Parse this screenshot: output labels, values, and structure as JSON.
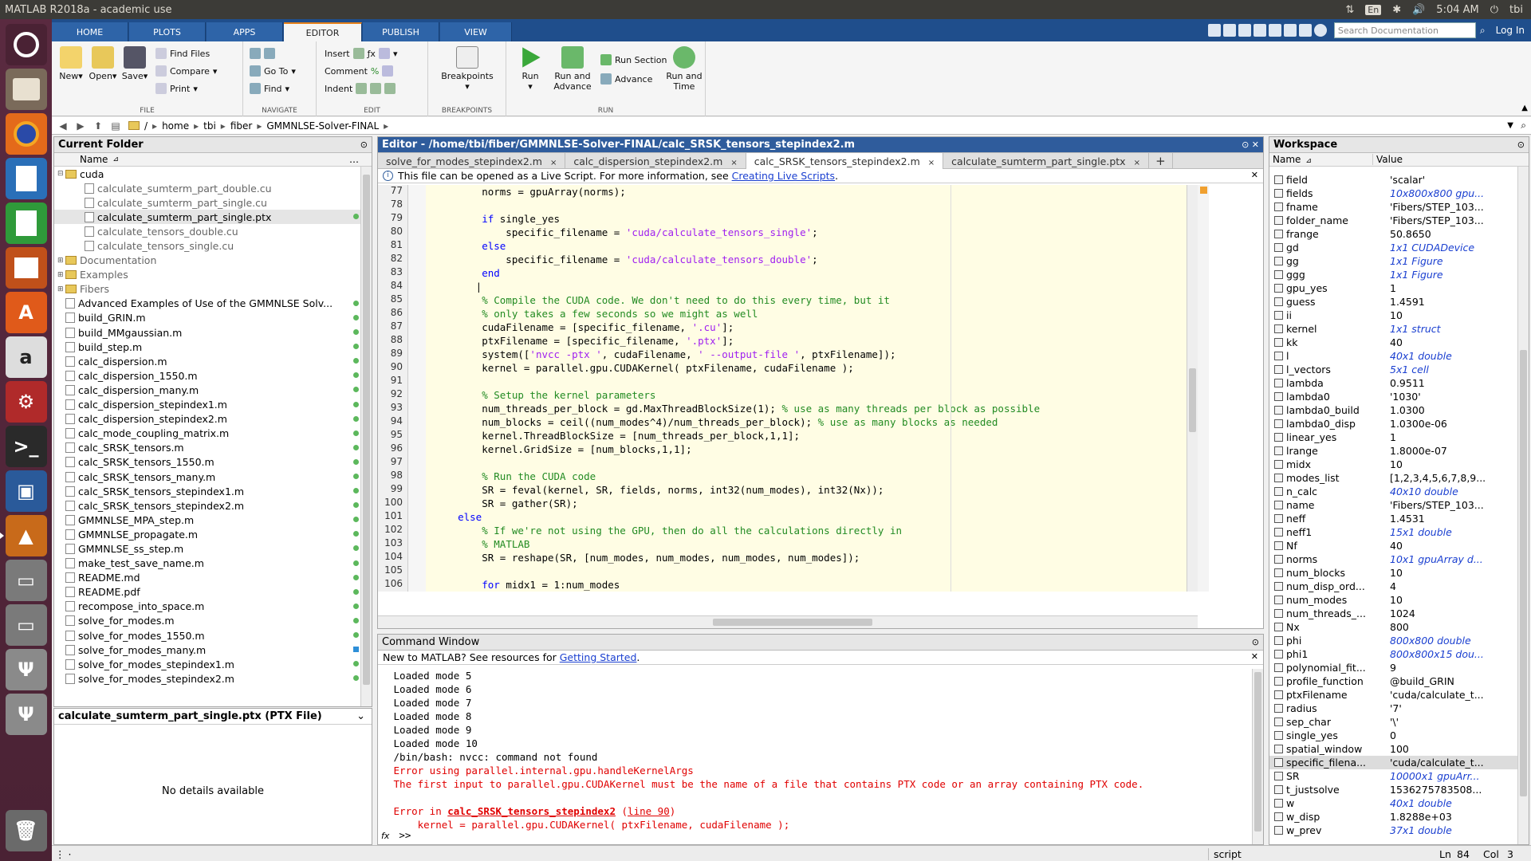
{
  "window_title": "MATLAB R2018a - academic use",
  "system_tray": {
    "lang": "En",
    "time": "5:04 AM",
    "user": "tbi"
  },
  "launcher": [
    "ubuntu-icon",
    "files-icon",
    "firefox-icon",
    "writer-icon",
    "calc-icon",
    "impress-icon",
    "software-center-icon",
    "amazon-icon",
    "settings-icon",
    "terminal-icon",
    "image-viewer-icon",
    "matlab-icon",
    "drive-icon",
    "drive-icon",
    "usb-icon",
    "usb-icon",
    "trash-icon"
  ],
  "ribbon_tabs": [
    "HOME",
    "PLOTS",
    "APPS",
    "EDITOR",
    "PUBLISH",
    "VIEW"
  ],
  "search_placeholder": "Search Documentation",
  "login": "Log In",
  "ribbon": {
    "file": {
      "label": "FILE",
      "new": "New",
      "open": "Open",
      "save": "Save",
      "find_files": "Find Files",
      "compare": "Compare",
      "print": "Print"
    },
    "navigate": {
      "label": "NAVIGATE",
      "go_to": "Go To",
      "find": "Find"
    },
    "edit": {
      "label": "EDIT",
      "insert": "Insert",
      "comment": "Comment",
      "indent": "Indent"
    },
    "breakpoints": {
      "label": "BREAKPOINTS",
      "breakpoints": "Breakpoints"
    },
    "run": {
      "label": "RUN",
      "run": "Run",
      "run_advance_1": "Run and",
      "run_advance_2": "Advance",
      "run_section": "Run Section",
      "advance": "Advance",
      "run_time_1": "Run and",
      "run_time_2": "Time"
    }
  },
  "breadcrumb": [
    "/",
    "home",
    "tbi",
    "fiber",
    "GMMNLSE-Solver-FINAL"
  ],
  "current_folder": {
    "title": "Current Folder",
    "col_name": "Name",
    "items": [
      {
        "name": "cuda",
        "kind": "folder",
        "open": true
      },
      {
        "name": "calculate_sumterm_part_double.cu",
        "kind": "file",
        "indent": 1,
        "grey": true
      },
      {
        "name": "calculate_sumterm_part_single.cu",
        "kind": "file",
        "indent": 1,
        "grey": true
      },
      {
        "name": "calculate_sumterm_part_single.ptx",
        "kind": "file",
        "indent": 1,
        "selected": true
      },
      {
        "name": "calculate_tensors_double.cu",
        "kind": "file",
        "indent": 1,
        "grey": true
      },
      {
        "name": "calculate_tensors_single.cu",
        "kind": "file",
        "indent": 1,
        "grey": true
      },
      {
        "name": "Documentation",
        "kind": "folder",
        "grey": true
      },
      {
        "name": "Examples",
        "kind": "folder",
        "grey": true
      },
      {
        "name": "Fibers",
        "kind": "folder",
        "grey": true
      },
      {
        "name": "Advanced Examples of Use of the GMMNLSE Solv...",
        "kind": "file"
      },
      {
        "name": "build_GRIN.m",
        "kind": "file"
      },
      {
        "name": "build_MMgaussian.m",
        "kind": "file"
      },
      {
        "name": "build_step.m",
        "kind": "file"
      },
      {
        "name": "calc_dispersion.m",
        "kind": "file"
      },
      {
        "name": "calc_dispersion_1550.m",
        "kind": "file"
      },
      {
        "name": "calc_dispersion_many.m",
        "kind": "file"
      },
      {
        "name": "calc_dispersion_stepindex1.m",
        "kind": "file"
      },
      {
        "name": "calc_dispersion_stepindex2.m",
        "kind": "file"
      },
      {
        "name": "calc_mode_coupling_matrix.m",
        "kind": "file"
      },
      {
        "name": "calc_SRSK_tensors.m",
        "kind": "file"
      },
      {
        "name": "calc_SRSK_tensors_1550.m",
        "kind": "file"
      },
      {
        "name": "calc_SRSK_tensors_many.m",
        "kind": "file"
      },
      {
        "name": "calc_SRSK_tensors_stepindex1.m",
        "kind": "file"
      },
      {
        "name": "calc_SRSK_tensors_stepindex2.m",
        "kind": "file"
      },
      {
        "name": "GMMNLSE_MPA_step.m",
        "kind": "file"
      },
      {
        "name": "GMMNLSE_propagate.m",
        "kind": "file"
      },
      {
        "name": "GMMNLSE_ss_step.m",
        "kind": "file"
      },
      {
        "name": "make_test_save_name.m",
        "kind": "file"
      },
      {
        "name": "README.md",
        "kind": "file"
      },
      {
        "name": "README.pdf",
        "kind": "file"
      },
      {
        "name": "recompose_into_space.m",
        "kind": "file"
      },
      {
        "name": "solve_for_modes.m",
        "kind": "file"
      },
      {
        "name": "solve_for_modes_1550.m",
        "kind": "file"
      },
      {
        "name": "solve_for_modes_many.m",
        "kind": "file",
        "blue": true
      },
      {
        "name": "solve_for_modes_stepindex1.m",
        "kind": "file"
      },
      {
        "name": "solve_for_modes_stepindex2.m",
        "kind": "file"
      }
    ],
    "details_title": "calculate_sumterm_part_single.ptx  (PTX File)",
    "details_empty": "No details available"
  },
  "editor": {
    "title": "Editor - /home/tbi/fiber/GMMNLSE-Solver-FINAL/calc_SRSK_tensors_stepindex2.m",
    "tabs": [
      "solve_for_modes_stepindex2.m",
      "calc_dispersion_stepindex2.m",
      "calc_SRSK_tensors_stepindex2.m",
      "calculate_sumterm_part_single.ptx"
    ],
    "tab_close": "×",
    "add_tab": "+",
    "notice_text": "This file can be opened as a Live Script. For more information, see ",
    "notice_link": "Creating Live Scripts",
    "notice_end": ".",
    "lines": [
      {
        "n": "77",
        "segs": [
          [
            "",
            "        norms = gpuArray(norms);"
          ]
        ]
      },
      {
        "n": "78",
        "segs": [
          [
            "",
            ""
          ]
        ]
      },
      {
        "n": "79",
        "segs": [
          [
            "",
            "        "
          ],
          [
            "kw",
            "if"
          ],
          [
            "",
            " single_yes"
          ]
        ]
      },
      {
        "n": "80",
        "segs": [
          [
            "",
            "            specific_filename = "
          ],
          [
            "str",
            "'cuda/calculate_tensors_single'"
          ],
          [
            "",
            ";"
          ]
        ]
      },
      {
        "n": "81",
        "segs": [
          [
            "",
            "        "
          ],
          [
            "kw",
            "else"
          ]
        ]
      },
      {
        "n": "82",
        "segs": [
          [
            "",
            "            specific_filename = "
          ],
          [
            "str",
            "'cuda/calculate_tensors_double'"
          ],
          [
            "",
            ";"
          ]
        ]
      },
      {
        "n": "83",
        "segs": [
          [
            "",
            "        "
          ],
          [
            "kw",
            "end"
          ]
        ]
      },
      {
        "n": "84",
        "segs": [
          [
            "",
            "       |"
          ]
        ]
      },
      {
        "n": "85",
        "segs": [
          [
            "",
            "        "
          ],
          [
            "cm",
            "% Compile the CUDA code. We don't need to do this every time, but it"
          ]
        ]
      },
      {
        "n": "86",
        "segs": [
          [
            "",
            "        "
          ],
          [
            "cm",
            "% only takes a few seconds so we might as well"
          ]
        ]
      },
      {
        "n": "87",
        "segs": [
          [
            "",
            "        cudaFilename = [specific_filename, "
          ],
          [
            "str",
            "'.cu'"
          ],
          [
            "",
            "];"
          ]
        ]
      },
      {
        "n": "88",
        "segs": [
          [
            "",
            "        ptxFilename = [specific_filename, "
          ],
          [
            "str",
            "'.ptx'"
          ],
          [
            "",
            "];"
          ]
        ]
      },
      {
        "n": "89",
        "segs": [
          [
            "",
            "        system(["
          ],
          [
            "str",
            "'nvcc -ptx '"
          ],
          [
            "",
            ", cudaFilename, "
          ],
          [
            "str",
            "' --output-file '"
          ],
          [
            "",
            ", ptxFilename]);"
          ]
        ]
      },
      {
        "n": "90",
        "segs": [
          [
            "",
            "        kernel = parallel.gpu.CUDAKernel( ptxFilename, cudaFilename );"
          ]
        ]
      },
      {
        "n": "91",
        "segs": [
          [
            "",
            ""
          ]
        ]
      },
      {
        "n": "92",
        "segs": [
          [
            "",
            "        "
          ],
          [
            "cm",
            "% Setup the kernel parameters"
          ]
        ]
      },
      {
        "n": "93",
        "segs": [
          [
            "",
            "        num_threads_per_block = gd.MaxThreadBlockSize(1); "
          ],
          [
            "cm",
            "% use as many threads per block as possible"
          ]
        ]
      },
      {
        "n": "94",
        "segs": [
          [
            "",
            "        num_blocks = ceil((num_modes^4)/num_threads_per_block); "
          ],
          [
            "cm",
            "% use as many blocks as needed"
          ]
        ]
      },
      {
        "n": "95",
        "segs": [
          [
            "",
            "        kernel.ThreadBlockSize = [num_threads_per_block,1,1];"
          ]
        ]
      },
      {
        "n": "96",
        "segs": [
          [
            "",
            "        kernel.GridSize = [num_blocks,1,1];"
          ]
        ]
      },
      {
        "n": "97",
        "segs": [
          [
            "",
            ""
          ]
        ]
      },
      {
        "n": "98",
        "segs": [
          [
            "",
            "        "
          ],
          [
            "cm",
            "% Run the CUDA code"
          ]
        ]
      },
      {
        "n": "99",
        "segs": [
          [
            "",
            "        SR = feval(kernel, SR, fields, norms, int32(num_modes), int32(Nx));"
          ]
        ]
      },
      {
        "n": "100",
        "segs": [
          [
            "",
            "        SR = gather(SR);"
          ]
        ]
      },
      {
        "n": "101",
        "segs": [
          [
            "",
            "    "
          ],
          [
            "kw",
            "else"
          ]
        ]
      },
      {
        "n": "102",
        "segs": [
          [
            "",
            "        "
          ],
          [
            "cm",
            "% If we're not using the GPU, then do all the calculations directly in"
          ]
        ]
      },
      {
        "n": "103",
        "segs": [
          [
            "",
            "        "
          ],
          [
            "cm",
            "% MATLAB"
          ]
        ]
      },
      {
        "n": "104",
        "segs": [
          [
            "",
            "        SR = reshape(SR, [num_modes, num_modes, num_modes, num_modes]);"
          ]
        ]
      },
      {
        "n": "105",
        "segs": [
          [
            "",
            ""
          ]
        ]
      },
      {
        "n": "106",
        "segs": [
          [
            "",
            "        "
          ],
          [
            "kw",
            "for"
          ],
          [
            "",
            " midx1 = 1:num_modes"
          ]
        ]
      }
    ]
  },
  "command_window": {
    "title": "Command Window",
    "notice_text": "New to MATLAB? See resources for ",
    "notice_link": "Getting Started",
    "notice_end": ".",
    "lines": [
      {
        "segs": [
          [
            "",
            " Loaded mode 5"
          ]
        ]
      },
      {
        "segs": [
          [
            "",
            " Loaded mode 6"
          ]
        ]
      },
      {
        "segs": [
          [
            "",
            " Loaded mode 7"
          ]
        ]
      },
      {
        "segs": [
          [
            "",
            " Loaded mode 8"
          ]
        ]
      },
      {
        "segs": [
          [
            "",
            " Loaded mode 9"
          ]
        ]
      },
      {
        "segs": [
          [
            "",
            " Loaded mode 10"
          ]
        ]
      },
      {
        "segs": [
          [
            "",
            " /bin/bash: nvcc: command not found"
          ]
        ]
      },
      {
        "segs": [
          [
            "err",
            " Error using parallel.internal.gpu.handleKernelArgs"
          ]
        ]
      },
      {
        "segs": [
          [
            "err",
            " The first input to parallel.gpu.CUDAKernel must be the name of a file that contains PTX code or an array containing PTX code."
          ]
        ]
      },
      {
        "segs": [
          [
            "",
            ""
          ]
        ]
      },
      {
        "segs": [
          [
            "err",
            " Error in "
          ],
          [
            "errlink",
            "calc_SRSK_tensors_stepindex2"
          ],
          [
            "err",
            " ("
          ],
          [
            "errline",
            "line 90"
          ],
          [
            "err",
            ")"
          ]
        ]
      },
      {
        "segs": [
          [
            "err",
            "     kernel = parallel.gpu.CUDAKernel( ptxFilename, cudaFilename );"
          ]
        ]
      }
    ],
    "prompt_fx": "fx",
    "prompt": ">>"
  },
  "workspace": {
    "title": "Workspace",
    "col_name": "Name",
    "col_value": "Value",
    "rows": [
      {
        "name": "field",
        "value": "'scalar'"
      },
      {
        "name": "fields",
        "value": "10x800x800 gpu...",
        "link": true
      },
      {
        "name": "fname",
        "value": "'Fibers/STEP_103..."
      },
      {
        "name": "folder_name",
        "value": "'Fibers/STEP_103..."
      },
      {
        "name": "frange",
        "value": "50.8650"
      },
      {
        "name": "gd",
        "value": "1x1 CUDADevice",
        "link": true
      },
      {
        "name": "gg",
        "value": "1x1 Figure",
        "link": true
      },
      {
        "name": "ggg",
        "value": "1x1 Figure",
        "link": true
      },
      {
        "name": "gpu_yes",
        "value": "1"
      },
      {
        "name": "guess",
        "value": "1.4591"
      },
      {
        "name": "ii",
        "value": "10"
      },
      {
        "name": "kernel",
        "value": "1x1 struct",
        "link": true
      },
      {
        "name": "kk",
        "value": "40"
      },
      {
        "name": "l",
        "value": "40x1 double",
        "link": true
      },
      {
        "name": "l_vectors",
        "value": "5x1 cell",
        "link": true
      },
      {
        "name": "lambda",
        "value": "0.9511"
      },
      {
        "name": "lambda0",
        "value": "'1030'"
      },
      {
        "name": "lambda0_build",
        "value": "1.0300"
      },
      {
        "name": "lambda0_disp",
        "value": "1.0300e-06"
      },
      {
        "name": "linear_yes",
        "value": "1"
      },
      {
        "name": "lrange",
        "value": "1.8000e-07"
      },
      {
        "name": "midx",
        "value": "10"
      },
      {
        "name": "modes_list",
        "value": "[1,2,3,4,5,6,7,8,9..."
      },
      {
        "name": "n_calc",
        "value": "40x10 double",
        "link": true
      },
      {
        "name": "name",
        "value": "'Fibers/STEP_103..."
      },
      {
        "name": "neff",
        "value": "1.4531"
      },
      {
        "name": "neff1",
        "value": "15x1 double",
        "link": true
      },
      {
        "name": "Nf",
        "value": "40"
      },
      {
        "name": "norms",
        "value": "10x1 gpuArray d...",
        "link": true
      },
      {
        "name": "num_blocks",
        "value": "10"
      },
      {
        "name": "num_disp_ord...",
        "value": "4"
      },
      {
        "name": "num_modes",
        "value": "10"
      },
      {
        "name": "num_threads_...",
        "value": "1024"
      },
      {
        "name": "Nx",
        "value": "800"
      },
      {
        "name": "phi",
        "value": "800x800 double",
        "link": true
      },
      {
        "name": "phi1",
        "value": "800x800x15 dou...",
        "link": true
      },
      {
        "name": "polynomial_fit...",
        "value": "9"
      },
      {
        "name": "profile_function",
        "value": "@build_GRIN"
      },
      {
        "name": "ptxFilename",
        "value": "'cuda/calculate_t..."
      },
      {
        "name": "radius",
        "value": "'7'"
      },
      {
        "name": "sep_char",
        "value": "'\\'"
      },
      {
        "name": "single_yes",
        "value": "0"
      },
      {
        "name": "spatial_window",
        "value": "100"
      },
      {
        "name": "specific_filena...",
        "value": "'cuda/calculate_t...",
        "selected": true
      },
      {
        "name": "SR",
        "value": "10000x1 gpuArr...",
        "link": true
      },
      {
        "name": "t_justsolve",
        "value": "1536275783508..."
      },
      {
        "name": "w",
        "value": "40x1 double",
        "link": true
      },
      {
        "name": "w_disp",
        "value": "1.8288e+03"
      },
      {
        "name": "w_prev",
        "value": "37x1 double",
        "link": true
      }
    ]
  },
  "status": {
    "mode": "script",
    "ln_label": "Ln",
    "ln": "84",
    "col_label": "Col",
    "col": "3"
  },
  "colors": {
    "ribbon_tab_bar": "#1f4e8c",
    "editor_bg": "#fffde4",
    "keyword": "#0000ff",
    "string": "#a020f0",
    "comment": "#228b22",
    "error": "#e00000",
    "launcher": "#4a2234"
  }
}
